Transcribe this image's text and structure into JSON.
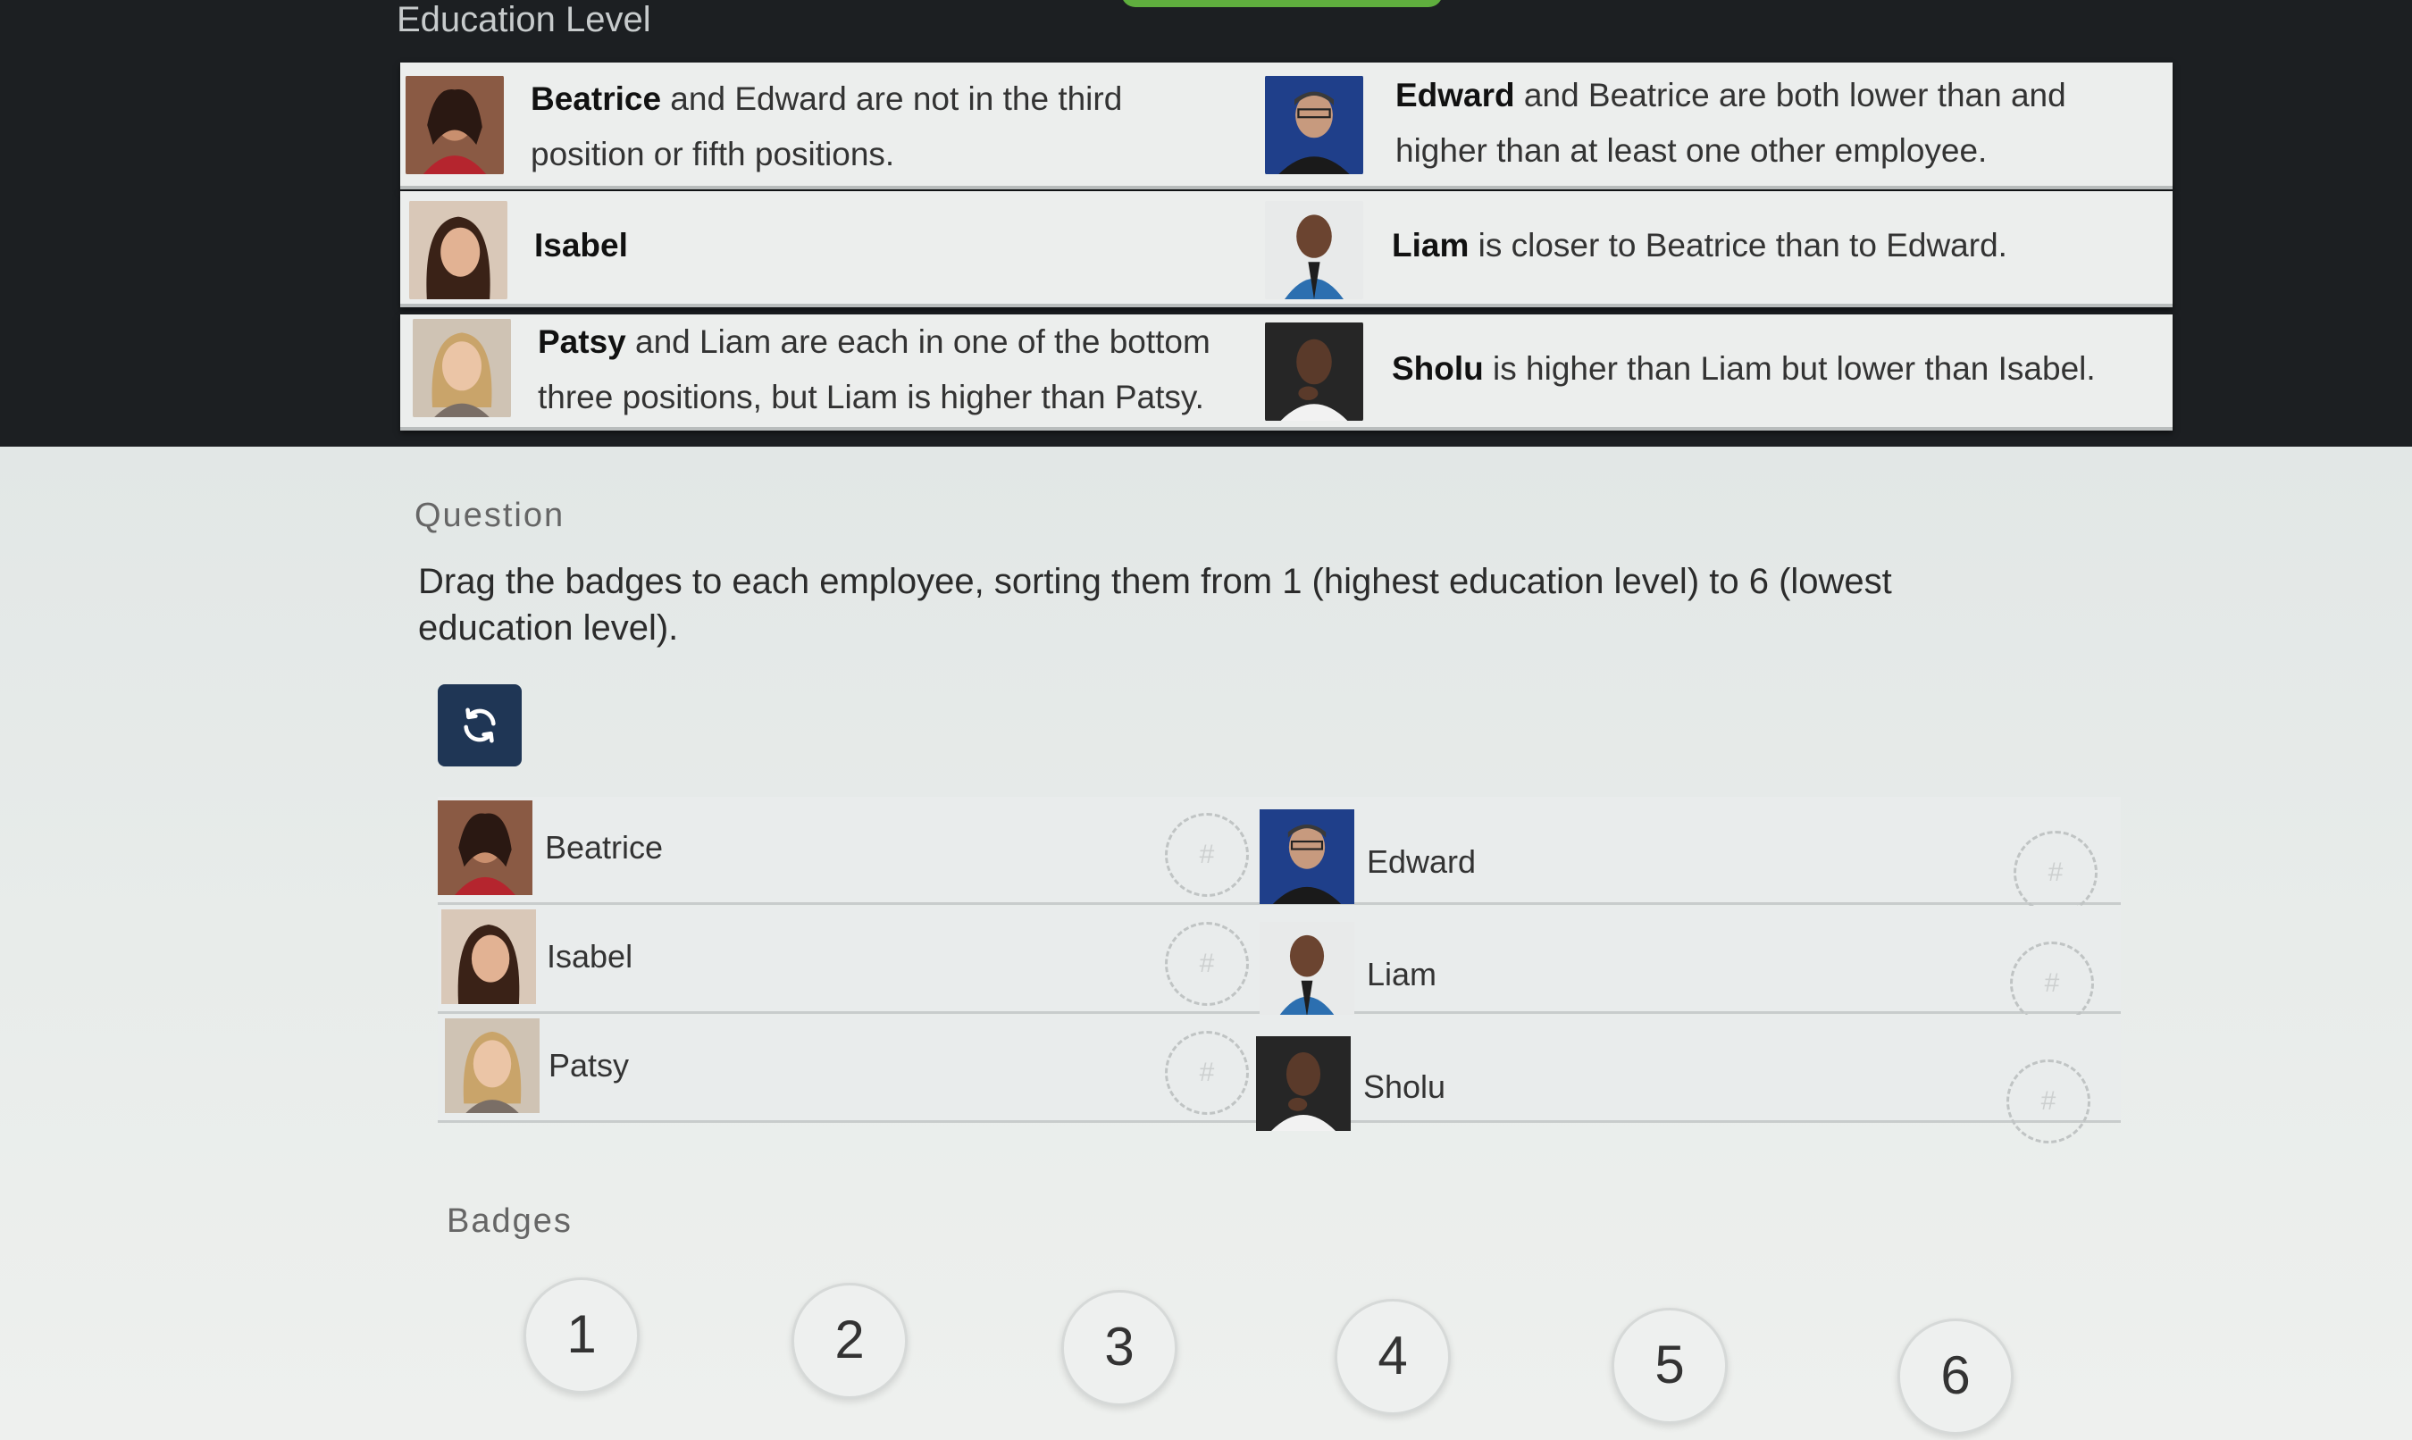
{
  "section_title": "Education Level",
  "clues": [
    {
      "left": {
        "person": "Beatrice",
        "bold": "Beatrice",
        "text": " and Edward are not in the third position or fifth positions."
      },
      "right": {
        "person": "Edward",
        "bold": "Edward",
        "text": " and Beatrice are both lower than and higher than at least one other employee."
      }
    },
    {
      "left": {
        "person": "Isabel",
        "bold": "Isabel",
        "text": ""
      },
      "right": {
        "person": "Liam",
        "bold": "Liam",
        "text": " is closer to Beatrice than to Edward."
      }
    },
    {
      "left": {
        "person": "Patsy",
        "bold": "Patsy",
        "text": " and Liam are each in one of the bottom three positions, but Liam is higher than Patsy."
      },
      "right": {
        "person": "Sholu",
        "bold": "Sholu",
        "text": " is higher than Liam but lower than Isabel."
      }
    }
  ],
  "question_label": "Question",
  "question_text": "Drag the badges to each employee, sorting them from 1 (highest education level) to 6 (lowest education level).",
  "reset_icon": "refresh-icon",
  "employees": [
    {
      "left": "Beatrice",
      "right": "Edward"
    },
    {
      "left": "Isabel",
      "right": "Liam"
    },
    {
      "left": "Patsy",
      "right": "Sholu"
    }
  ],
  "slot_placeholder": "#",
  "badges_label": "Badges",
  "badges": [
    "1",
    "2",
    "3",
    "4",
    "5",
    "6"
  ],
  "colors": {
    "reset_button": "#1f3655",
    "dark_panel": "#1c1f22",
    "accent_tab": "#5fae3e"
  }
}
